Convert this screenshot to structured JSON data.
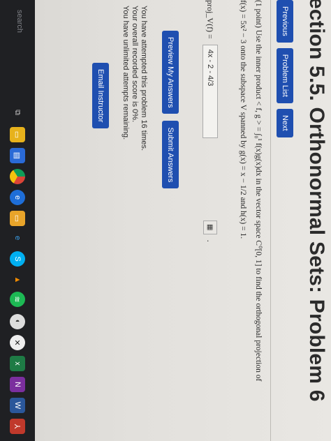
{
  "page": {
    "title": "ection 5.5. Orthonormal Sets: Problem 6"
  },
  "nav": {
    "previous": "Previous",
    "problem_list": "Problem List",
    "next": "Next"
  },
  "question": {
    "line1": "(1 point) Use the inner product < f, g > = ∫₀¹ f(x)g(x)dx in the vector space C⁰[0, 1] to find the orthogonal projection of",
    "line2": "f(x) = 5x² − 3 onto the subspace V spanned by g(x) = x − 1/2 and h(x) = 1.",
    "proj_label": "proj_V(f) =",
    "answer_value": "4x - 2 - 4/3",
    "period": "."
  },
  "actions": {
    "preview": "Preview My Answers",
    "submit": "Submit Answers"
  },
  "status": {
    "line1": "You have attempted this problem 16 times.",
    "line2": "Your overall recorded score is 0%.",
    "line3": "You have unlimited attempts remaining."
  },
  "email": {
    "label": "Email Instructor"
  },
  "taskbar": {
    "search": "search",
    "icons": [
      "task-view-icon",
      "file-explorer-icon",
      "store-icon",
      "chrome-icon",
      "edge-icon",
      "files-icon",
      "ie-icon",
      "skype-icon",
      "vlc-icon",
      "spotify-icon",
      "media-icon",
      "xbox-icon",
      "excel-icon",
      "onenote-icon",
      "word-icon",
      "acrobat-icon"
    ]
  }
}
